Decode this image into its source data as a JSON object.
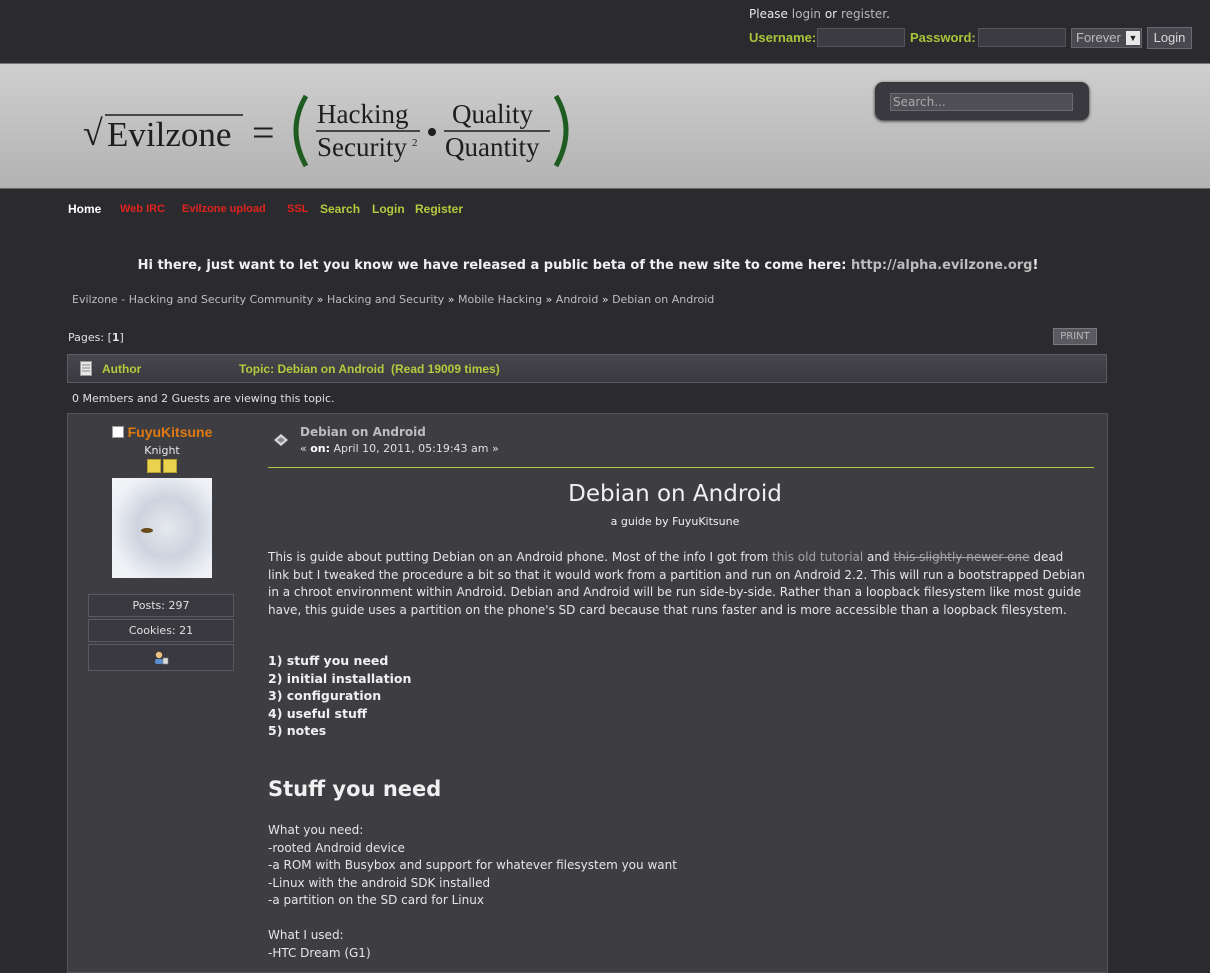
{
  "login": {
    "please": "Please",
    "login_link": "login",
    "or": "or",
    "register_link": "register",
    "period": ".",
    "username_label": "Username:",
    "password_label": "Password:",
    "duration": "Forever",
    "login_button": "Login"
  },
  "header": {
    "logo_sqrt": "√",
    "logo_evilzone": "Evilzone",
    "logo_equals": "=",
    "logo_hacking": "Hacking",
    "logo_security": "Security",
    "logo_exp": "2",
    "logo_quality": "Quality",
    "logo_quantity": "Quantity",
    "search_placeholder": "Search..."
  },
  "nav": {
    "home": "Home",
    "webirc": "Web IRC",
    "upload": "Evilzone upload",
    "ssl": "SSL",
    "search": "Search",
    "login": "Login",
    "register": "Register"
  },
  "announce": {
    "text": "Hi there, just want to let you know we have released a public beta of the new site to come here: ",
    "url": "http://alpha.evilzone.org",
    "end": "!"
  },
  "breadcrumb": {
    "items": [
      "Evilzone - Hacking and Security Community",
      "Hacking and Security",
      "Mobile Hacking",
      "Android",
      "Debian on Android"
    ],
    "separator": "»"
  },
  "pagination": {
    "label": "Pages: [",
    "current": "1",
    "close": "]"
  },
  "print_button": "PRINT",
  "topic_bar": {
    "author": "Author",
    "topic": "Topic: Debian on Android  (Read 19009 times)"
  },
  "viewing": "0 Members and 2 Guests are viewing this topic.",
  "poster": {
    "name": "FuyuKitsune",
    "rank": "Knight",
    "stars": 2,
    "posts": "Posts: 297",
    "cookies": "Cookies: 21"
  },
  "post": {
    "subject": "Debian on Android",
    "date_prefix": "« ",
    "date_on": "on:",
    "date": " April 10, 2011, 05:19:43 am »",
    "title": "Debian on Android",
    "subtitle": "a guide by FuyuKitsune",
    "intro_1": "This is guide about putting Debian on an Android phone. Most of the info I got from ",
    "intro_link1": "this old tutorial",
    "intro_2": " and ",
    "intro_strike": "this slightly newer one",
    "intro_3": " dead link but I tweaked the procedure a bit so that it would work from a partition and run on Android 2.2. This will run a bootstrapped Debian in a chroot environment within Android. Debian and Android will be run side-by-side. Rather than a loopback filesystem like most guide have, this guide uses a partition on the phone's SD card because that runs faster and is more accessible than a loopback filesystem.",
    "toc": [
      "1) stuff you need",
      "2) initial installation",
      "3) configuration",
      "4) useful stuff",
      "5) notes"
    ],
    "stuff_heading": "Stuff you need",
    "need_list": [
      "What you need:",
      "-rooted Android device",
      "-a ROM with Busybox and support for whatever filesystem you want",
      "-Linux with the android SDK installed",
      "-a partition on the SD card for Linux"
    ],
    "used_list": [
      "What I used:",
      "-HTC Dream (G1)"
    ]
  },
  "colors": {
    "accent_green": "#b6c93e",
    "nav_red": "#e0231c",
    "poster_orange": "#e07a10",
    "background": "#2b2a2f",
    "post_bg": "#3e3d42"
  }
}
